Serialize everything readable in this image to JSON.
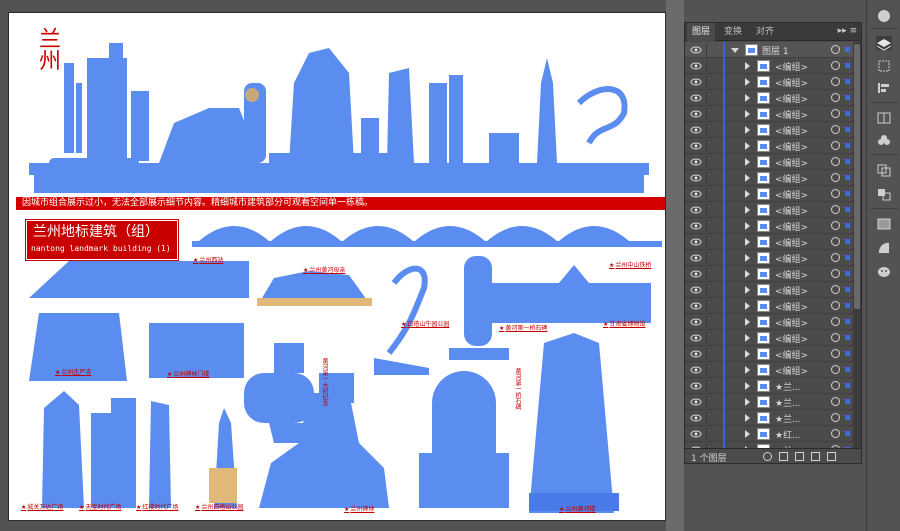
{
  "artboard": {
    "vertical_title": "兰州",
    "banner": "因城市组合展示过小，无法全部展示细节内容。精细城市建筑部分可观看空间单一栋稿。",
    "title_cn": "兰州地标建筑（组）",
    "title_en": "nantong landmark building (1)",
    "captions": [
      "兰州西站",
      "兰州黄河母亲",
      "兰州中山铁桥",
      "白塔山牛园公园",
      "黄河第一桥石碑",
      "甘肃省博物馆",
      "兰州庄严寺",
      "兰州碑林门楼",
      "城关万达广场",
      "天宝时代广场",
      "红楼时代广场",
      "兰州白塔山公园",
      "兰州碑林",
      "兰州黄河楼"
    ],
    "vertical_captions": [
      "黄河第一大桥纪念",
      "黄河第一桥石碑"
    ]
  },
  "panel": {
    "tabs": [
      "图层",
      "变换",
      "对齐"
    ],
    "menu_icon": "panel-menu-icon",
    "layer_name": "图层 1",
    "rows": [
      "<编组>",
      "<编组>",
      "<编组>",
      "<编组>",
      "<编组>",
      "<编组>",
      "<编组>",
      "<编组>",
      "<编组>",
      "<编组>",
      "<编组>",
      "<编组>",
      "<编组>",
      "<编组>",
      "<编组>",
      "<编组>",
      "<编组>",
      "<编组>",
      "<编组>",
      "<编组>",
      "★兰...",
      "★兰...",
      "★兰...",
      "★红...",
      "★兰..."
    ],
    "footer_count": "1 个图层",
    "colors": {
      "selection": "#3b6cf0",
      "accent_red": "#c80000",
      "building_blue": "#5b8cf0"
    }
  },
  "toolstrip": {
    "icons": [
      "color-icon",
      "layers-icon",
      "transform-icon",
      "align-icon",
      "artboards-icon",
      "symbols-icon",
      "pathfinder-icon",
      "appearance-icon",
      "gradient-icon",
      "transparency-icon",
      "brushes-icon"
    ]
  }
}
